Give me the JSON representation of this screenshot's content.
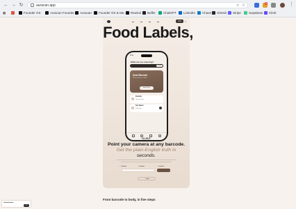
{
  "browser": {
    "url": "auracan.app",
    "bookmarks": [
      {
        "label": "Founder OS",
        "color": "#e0533d"
      },
      {
        "label": "Auracan Founder...",
        "color": "#111111"
      },
      {
        "label": "Auracan",
        "color": "#111111"
      },
      {
        "label": "Founder OS & Me...",
        "color": "#111111"
      },
      {
        "label": "Rewind",
        "color": "#111111"
      },
      {
        "label": "Buffer",
        "color": "#222222"
      },
      {
        "label": "ChatGPT",
        "color": "#10a37f"
      },
      {
        "label": "LinkedIn",
        "color": "#0a66c2"
      },
      {
        "label": "Chase",
        "color": "#117aca"
      },
      {
        "label": "GitHub",
        "color": "#24292e"
      },
      {
        "label": "Stripe",
        "color": "#635bff"
      },
      {
        "label": "Supabase",
        "color": "#3ecf8e"
      },
      {
        "label": "Clerk",
        "color": "#6c47ff"
      }
    ],
    "extension_badge": "6"
  },
  "site": {
    "headline": "Food Labels,",
    "nav": {
      "cta": "Join"
    },
    "phone": {
      "time": "9:41",
      "question": "What are we scanning?",
      "search_btn": "Scan",
      "scan_card_title": "Scan Barcode",
      "scan_card_sub": "Point camera at label",
      "scan_card_btn": "Start Scan",
      "rows": [
        {
          "title": "Granola",
          "sub": "Nature Valley"
        },
        {
          "title": "Soy Sauce",
          "sub": "Kikkoman"
        }
      ]
    },
    "brand_mini": "OLBO",
    "tagline_1": "Point your camera at any barcode.",
    "tagline_2": "Get the plain-English truth in",
    "tagline_3": "seconds.",
    "scroll_label": "Scroll to explore",
    "section_title": "From barcode to body, in five steps",
    "cookie_button": "OK"
  }
}
